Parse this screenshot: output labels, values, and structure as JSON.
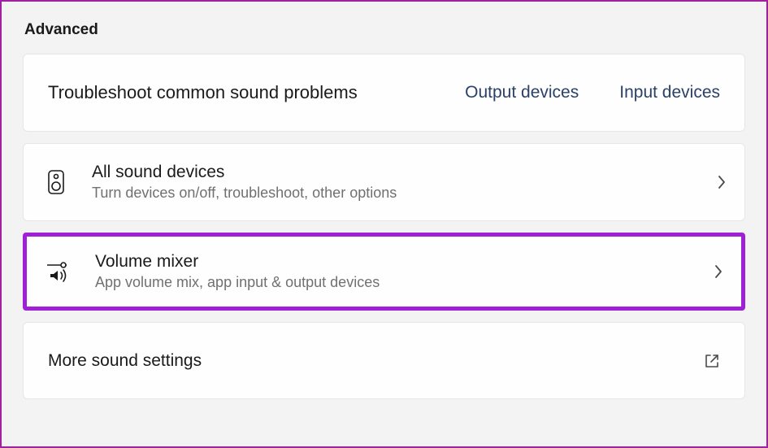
{
  "section": {
    "title": "Advanced"
  },
  "troubleshoot": {
    "title": "Troubleshoot common sound problems",
    "output_link": "Output devices",
    "input_link": "Input devices"
  },
  "items": {
    "all_devices": {
      "title": "All sound devices",
      "subtitle": "Turn devices on/off, troubleshoot, other options"
    },
    "volume_mixer": {
      "title": "Volume mixer",
      "subtitle": "App volume mix, app input & output devices"
    }
  },
  "more": {
    "title": "More sound settings"
  }
}
